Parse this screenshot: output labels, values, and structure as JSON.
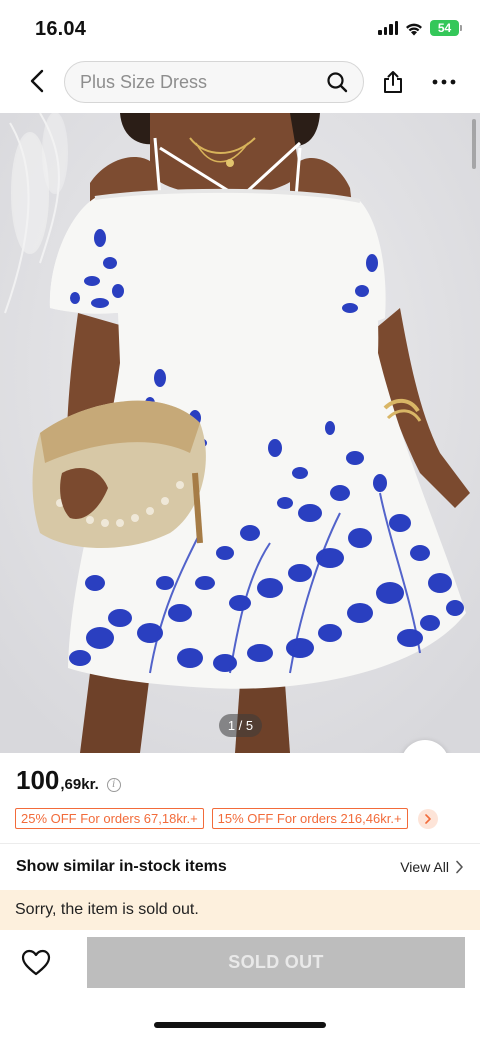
{
  "status_bar": {
    "time": "16.04",
    "battery_level": "54",
    "icons": [
      "cellular-signal-icon",
      "wifi-icon",
      "battery-icon"
    ]
  },
  "header": {
    "search_placeholder": "Plus Size Dress",
    "icons": [
      "back-chevron-icon",
      "search-icon",
      "share-icon",
      "more-icon"
    ]
  },
  "product": {
    "image_description_icon": "product-photo",
    "image_counter": "1 / 5",
    "price_main": "100",
    "price_sub": ",69kr.",
    "info_symbol": "i",
    "coupons": [
      {
        "label": "25% OFF For orders 67,18kr.+"
      },
      {
        "label": "15% OFF For orders 216,46kr.+"
      }
    ]
  },
  "similar": {
    "title": "Show similar in-stock items",
    "view_all": "View All"
  },
  "notice": {
    "sold_out_message": "Sorry, the item is sold out."
  },
  "bottom_bar": {
    "action_label": "SOLD OUT"
  },
  "colors": {
    "accent_orange": "#f26b3a",
    "banner_bg": "#fdf0dd",
    "disabled_button": "#bdbdbd",
    "battery_green": "#34c759",
    "dress_blue": "#2a3fc0"
  }
}
